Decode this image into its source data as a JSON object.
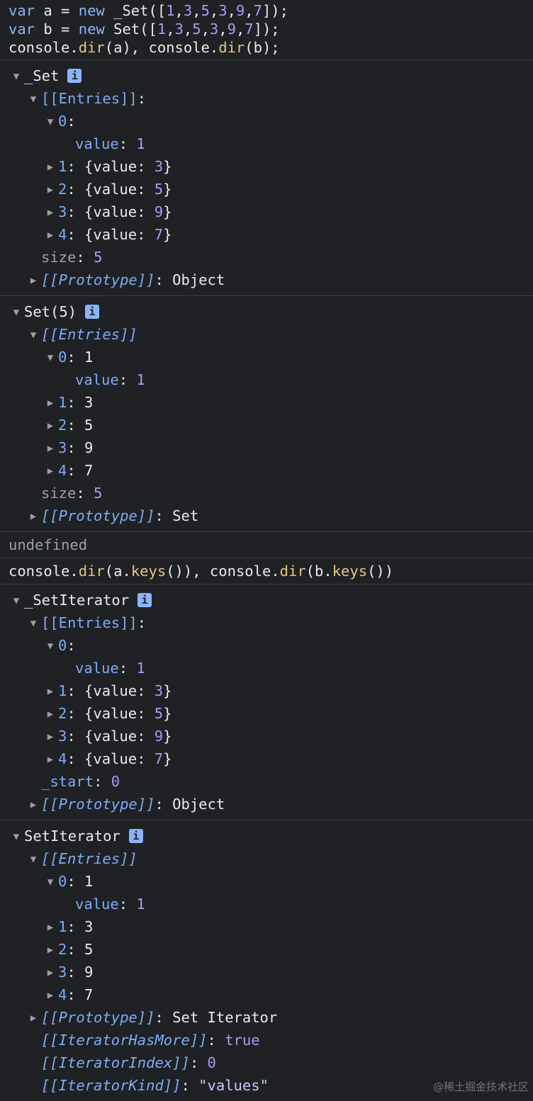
{
  "input1": {
    "line1": [
      "var",
      " a = ",
      "new",
      " _Set([",
      "1",
      ",",
      "3",
      ",",
      "5",
      ",",
      "3",
      ",",
      "9",
      ",",
      "7",
      "]);"
    ],
    "line2": [
      "var",
      " b = ",
      "new",
      " Set([",
      "1",
      ",",
      "3",
      ",",
      "5",
      ",",
      "3",
      ",",
      "9",
      ",",
      "7",
      "]);"
    ],
    "line3": [
      "console.",
      "dir",
      "(a), console.",
      "dir",
      "(b);"
    ]
  },
  "obj1": {
    "title": "_Set",
    "entries_label": "[[Entries]]",
    "entry0_key": "0",
    "value_key": "value",
    "value_val": "1",
    "items": [
      {
        "k": "1",
        "v": "3"
      },
      {
        "k": "2",
        "v": "5"
      },
      {
        "k": "3",
        "v": "9"
      },
      {
        "k": "4",
        "v": "7"
      }
    ],
    "size_key": "size",
    "size_val": "5",
    "proto_label": "[[Prototype]]",
    "proto_val": "Object"
  },
  "obj2": {
    "title": "Set(5)",
    "entries_label": "[[Entries]]",
    "entry0": "0: 1",
    "value_key": "value",
    "value_val": "1",
    "items": [
      {
        "k": "1",
        "v": "3"
      },
      {
        "k": "2",
        "v": "5"
      },
      {
        "k": "3",
        "v": "9"
      },
      {
        "k": "4",
        "v": "7"
      }
    ],
    "size_key": "size",
    "size_val": "5",
    "proto_label": "[[Prototype]]",
    "proto_val": "Set"
  },
  "return1": "undefined",
  "input2": [
    "console.",
    "dir",
    "(a.",
    "keys",
    "()), console.",
    "dir",
    "(b.",
    "keys",
    "())"
  ],
  "obj3": {
    "title": "_SetIterator",
    "entries_label": "[[Entries]]",
    "entry0_key": "0",
    "value_key": "value",
    "value_val": "1",
    "items": [
      {
        "k": "1",
        "v": "3"
      },
      {
        "k": "2",
        "v": "5"
      },
      {
        "k": "3",
        "v": "9"
      },
      {
        "k": "4",
        "v": "7"
      }
    ],
    "start_key": "_start",
    "start_val": "0",
    "proto_label": "[[Prototype]]",
    "proto_val": "Object"
  },
  "obj4": {
    "title": "SetIterator",
    "entries_label": "[[Entries]]",
    "entry0_key": "0",
    "entry0_val": "1",
    "value_key": "value",
    "value_val": "1",
    "items": [
      {
        "k": "1",
        "v": "3"
      },
      {
        "k": "2",
        "v": "5"
      },
      {
        "k": "3",
        "v": "9"
      },
      {
        "k": "4",
        "v": "7"
      }
    ],
    "proto_label": "[[Prototype]]",
    "proto_val": "Set Iterator",
    "hasmore_key": "[[IteratorHasMore]]",
    "hasmore_val": "true",
    "index_key": "[[IteratorIndex]]",
    "index_val": "0",
    "kind_key": "[[IteratorKind]]",
    "kind_val": "\"values\""
  },
  "info_icon": "i",
  "watermark": "@稀土掘金技术社区",
  "colors": {
    "background": "#202124",
    "keyword": "#8ab4f8",
    "number": "#a79cf6",
    "function": "#ddca7e",
    "property": "#7cacf8"
  },
  "icons": {
    "expanded": "triangle-down-icon",
    "collapsed": "triangle-right-icon",
    "info": "info-icon"
  }
}
